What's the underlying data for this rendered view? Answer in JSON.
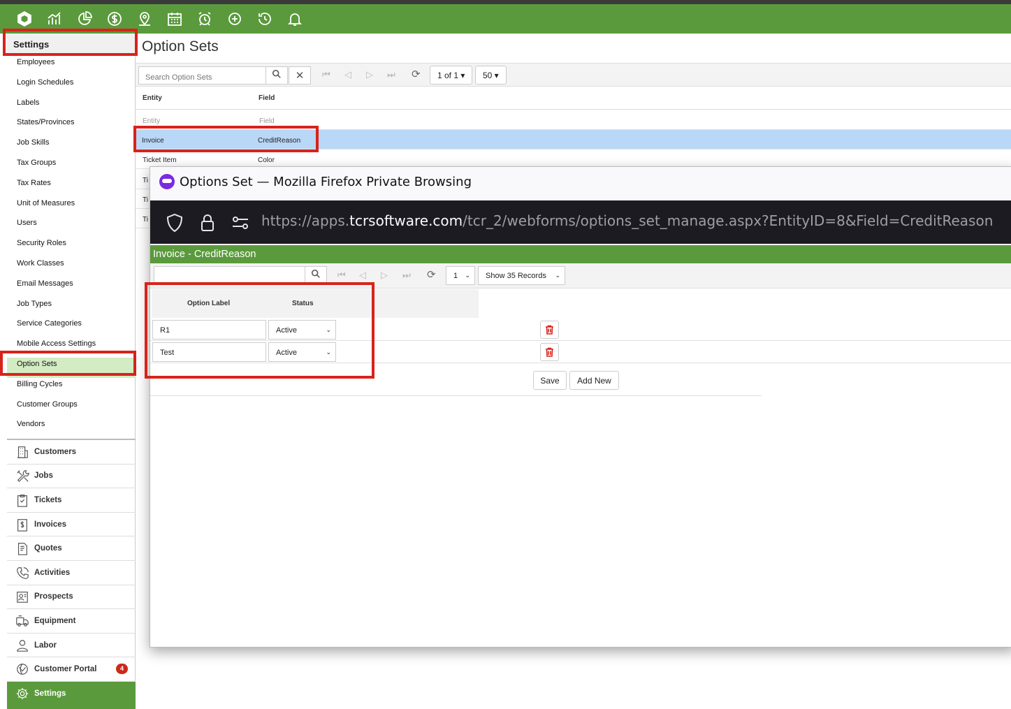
{
  "page": {
    "title": "Option Sets"
  },
  "topbar": {
    "icons": [
      "logo-hexagon-icon",
      "chart-icon",
      "pie-icon",
      "dollar-icon",
      "map-pin-icon",
      "calendar-icon",
      "alarm-icon",
      "plus-circle-icon",
      "history-icon",
      "bell-icon"
    ]
  },
  "sidebar": {
    "header": "Settings",
    "sub_items": [
      "Employees",
      "Login Schedules",
      "Labels",
      "States/Provinces",
      "Job Skills",
      "Tax Groups",
      "Tax Rates",
      "Unit of Measures",
      "Users",
      "Security Roles",
      "Work Classes",
      "Email Messages",
      "Job Types",
      "Service Categories",
      "Mobile Access Settings",
      "Option Sets",
      "Billing Cycles",
      "Customer Groups",
      "Vendors"
    ],
    "active_sub": "Option Sets",
    "modules": [
      {
        "label": "Customers",
        "icon": "building-icon"
      },
      {
        "label": "Jobs",
        "icon": "tools-icon"
      },
      {
        "label": "Tickets",
        "icon": "clipboard-icon"
      },
      {
        "label": "Invoices",
        "icon": "invoice-dollar-icon"
      },
      {
        "label": "Quotes",
        "icon": "quote-doc-icon"
      },
      {
        "label": "Activities",
        "icon": "phone-icon"
      },
      {
        "label": "Prospects",
        "icon": "contact-card-icon"
      },
      {
        "label": "Equipment",
        "icon": "truck-icon"
      },
      {
        "label": "Labor",
        "icon": "person-icon"
      },
      {
        "label": "Customer Portal",
        "icon": "portal-icon",
        "badge": "4"
      },
      {
        "label": "Settings",
        "icon": "gear-icon"
      }
    ]
  },
  "toolbar": {
    "search_placeholder": "Search Option Sets",
    "pager": "1 of 1 ▾",
    "page_size": "50 ▾"
  },
  "grid": {
    "columns": [
      "Entity",
      "Field"
    ],
    "filter_row": [
      "Entity",
      "Field"
    ],
    "rows": [
      {
        "entity": "Invoice",
        "field": "CreditReason"
      },
      {
        "entity": "Ticket Item",
        "field": "Color"
      },
      {
        "entity": "Ti",
        "field": ""
      },
      {
        "entity": "Ti",
        "field": ""
      },
      {
        "entity": "Ti",
        "field": ""
      }
    ]
  },
  "popup": {
    "window_title": "Options Set — Mozilla Firefox Private Browsing",
    "url_prefix": "https://apps.",
    "url_domain": "tcrsoftware.com",
    "url_path": "/tcr_2/webforms/options_set_manage.aspx?EntityID=8&Field=CreditReason",
    "header": "Invoice - CreditReason",
    "page_select": "1",
    "records_select": "Show 35 Records",
    "columns": [
      "Option Label",
      "Status"
    ],
    "options": [
      {
        "label": "R1",
        "status": "Active"
      },
      {
        "label": "Test",
        "status": "Active"
      }
    ],
    "save_label": "Save",
    "add_new_label": "Add New"
  }
}
